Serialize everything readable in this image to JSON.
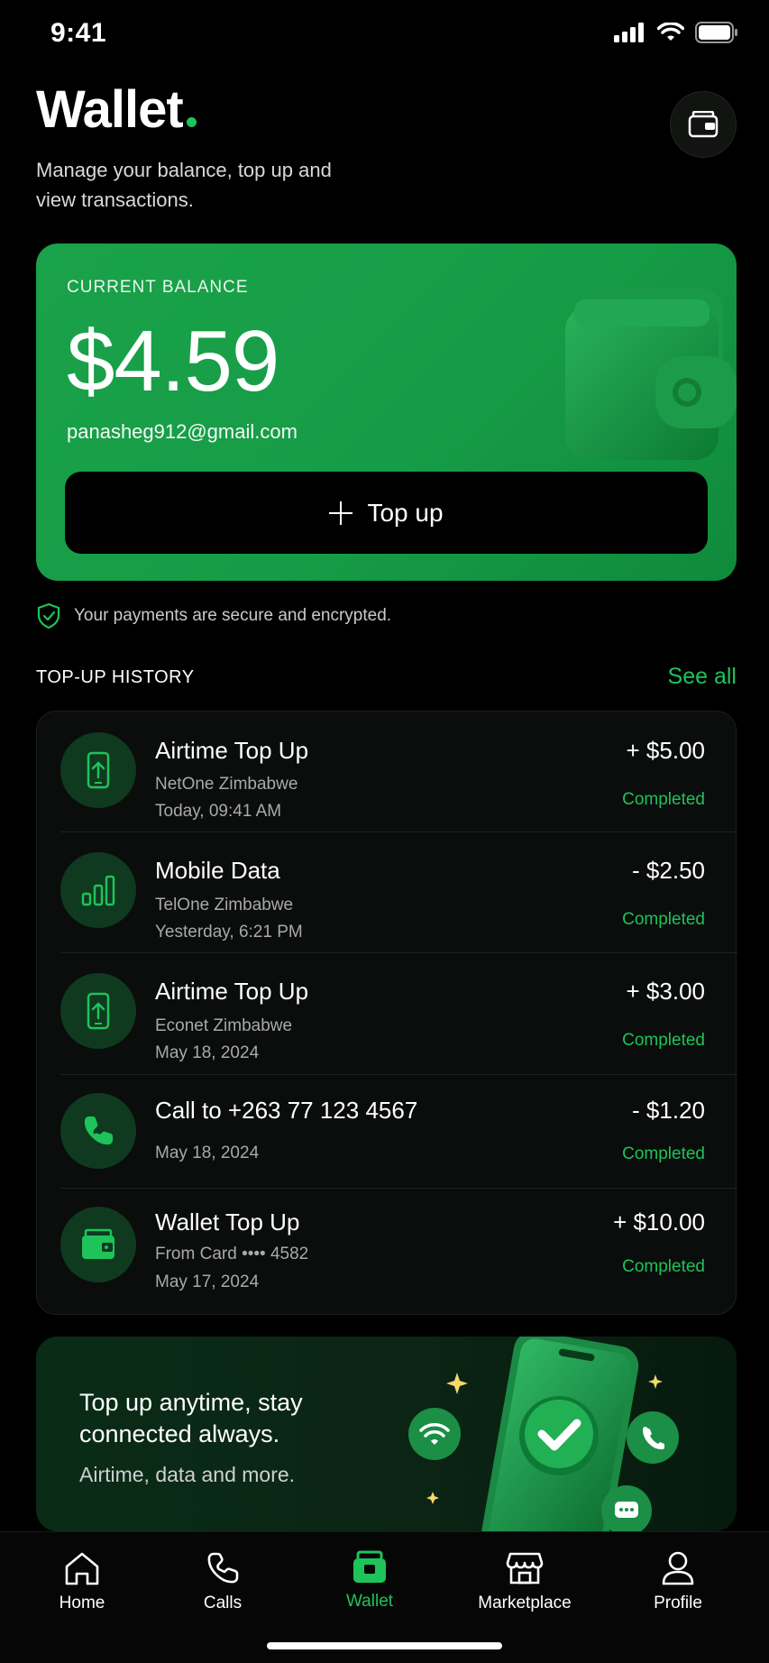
{
  "status_bar": {
    "time": "9:41"
  },
  "header": {
    "title": "Wallet",
    "subtitle": "Manage your balance, top up and view transactions."
  },
  "balance_card": {
    "label": "CURRENT BALANCE",
    "amount": "$4.59",
    "email": "panasheg912@gmail.com",
    "topup_label": "Top up"
  },
  "secure_note": "Your payments are secure and encrypted.",
  "history": {
    "title": "TOP-UP HISTORY",
    "see_all": "See all",
    "items": [
      {
        "icon": "phone-topup-icon",
        "title": "Airtime Top Up",
        "provider": "NetOne Zimbabwe",
        "date": "Today, 09:41 AM",
        "amount": "+ $5.00",
        "status": "Completed"
      },
      {
        "icon": "signal-bars-icon",
        "title": "Mobile Data",
        "provider": "TelOne Zimbabwe",
        "date": "Yesterday, 6:21 PM",
        "amount": "- $2.50",
        "status": "Completed"
      },
      {
        "icon": "phone-topup-icon",
        "title": "Airtime Top Up",
        "provider": "Econet Zimbabwe",
        "date": "May 18, 2024",
        "amount": "+ $3.00",
        "status": "Completed"
      },
      {
        "icon": "phone-call-icon",
        "title": "Call to +263 77 123 4567",
        "provider": "",
        "date": "May 18, 2024",
        "amount": "- $1.20",
        "status": "Completed"
      },
      {
        "icon": "wallet-icon",
        "title": "Wallet Top Up",
        "provider": "From Card •••• 4582",
        "date": "May 17, 2024",
        "amount": "+ $10.00",
        "status": "Completed"
      }
    ]
  },
  "promo": {
    "title": "Top up anytime, stay connected always.",
    "subtitle": "Airtime, data and more."
  },
  "bottom_nav": {
    "items": [
      {
        "label": "Home",
        "icon": "home-icon"
      },
      {
        "label": "Calls",
        "icon": "phone-icon"
      },
      {
        "label": "Wallet",
        "icon": "wallet-icon",
        "active": true
      },
      {
        "label": "Marketplace",
        "icon": "store-icon"
      },
      {
        "label": "Profile",
        "icon": "user-icon"
      }
    ]
  },
  "colors": {
    "accent": "#1ec35a",
    "card": "#169c46",
    "background": "#000000"
  }
}
